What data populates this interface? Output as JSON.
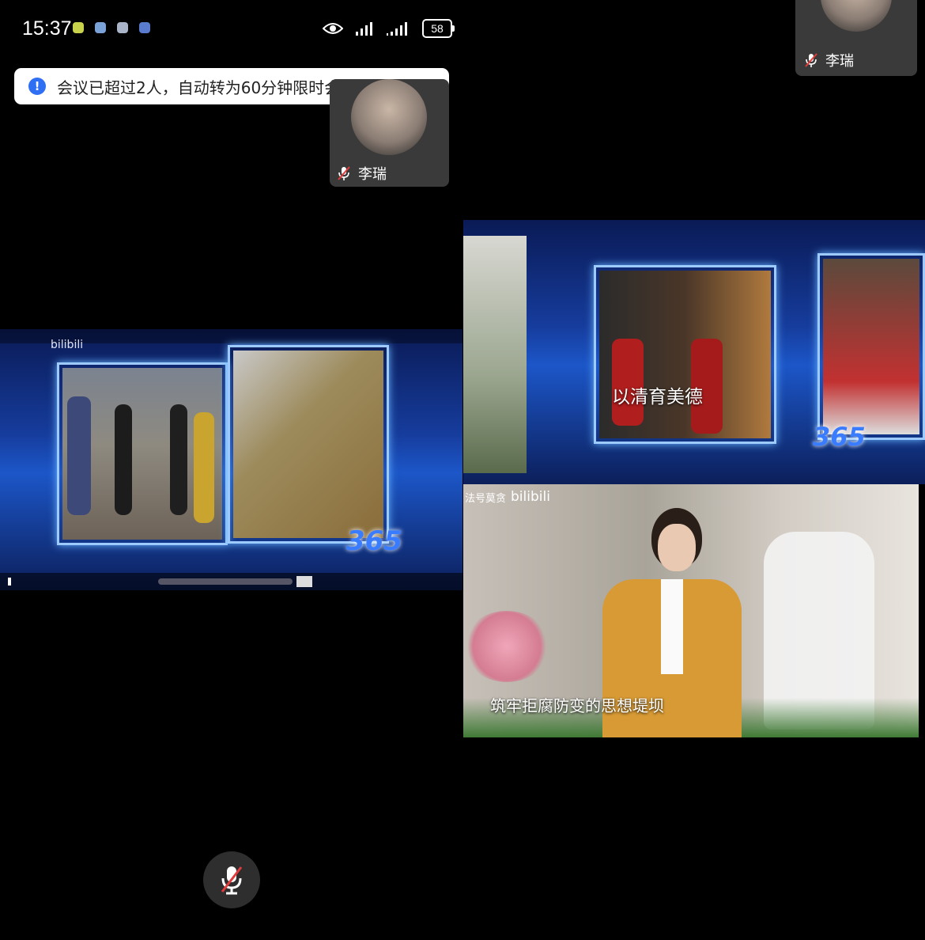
{
  "status_bar": {
    "time": "15:37",
    "battery": "58",
    "icons": [
      "notification-dot-icon",
      "app-icon",
      "app-icon",
      "app-icon"
    ]
  },
  "notice": {
    "text": "会议已超过2人，自动转为60分钟限时会议。",
    "close_icon": "close-icon",
    "accent": "#2f6ff4"
  },
  "participants": [
    {
      "name": "李瑞",
      "mic": "muted"
    },
    {
      "name": "李瑞",
      "mic": "muted"
    }
  ],
  "shared_video_left": {
    "brand": "bilibili",
    "logo": "365"
  },
  "shared_video_right_top": {
    "caption": "以清育美德",
    "logo": "365"
  },
  "shared_video_right_bottom": {
    "watermark": "法号莫贪",
    "brand": "bilibili",
    "caption": "筑牢拒腐防变的思想堤坝"
  },
  "controls": {
    "mic_button": "mic-muted-icon"
  }
}
